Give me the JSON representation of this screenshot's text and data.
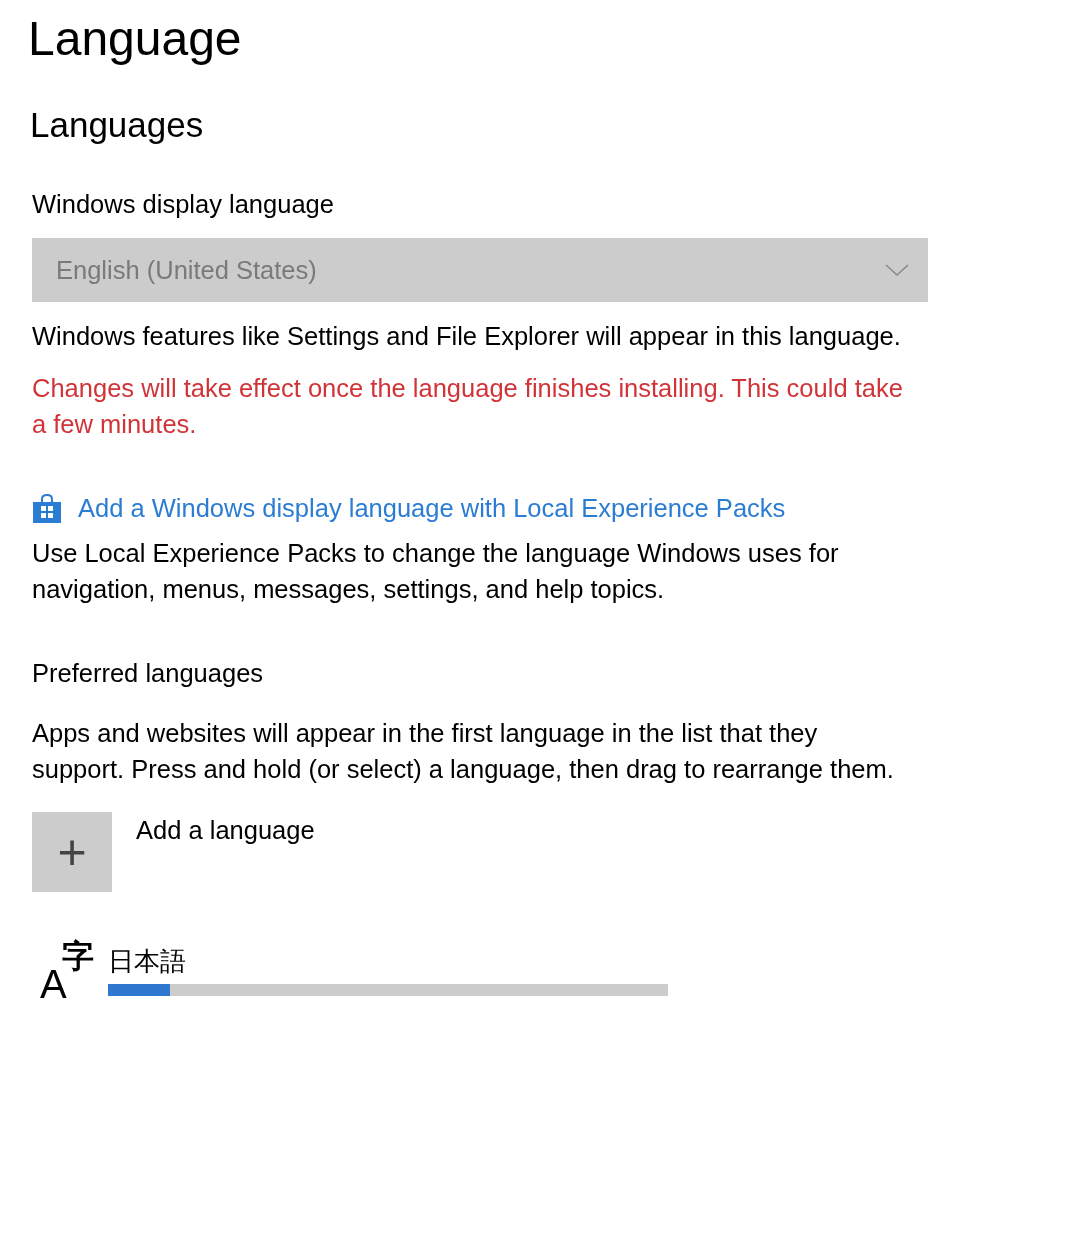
{
  "page_title": "Language",
  "section_title": "Languages",
  "display_language": {
    "label": "Windows display language",
    "value": "English (United States)",
    "disabled": true,
    "description": "Windows features like Settings and File Explorer will appear in this language.",
    "warning": "Changes will take effect once the language finishes installing. This could take a few minutes."
  },
  "local_experience": {
    "link": "Add a Windows display language with Local Experience Packs",
    "description": "Use Local Experience Packs to change the language Windows uses for navigation, menus, messages, settings, and help topics."
  },
  "preferred": {
    "label": "Preferred languages",
    "description": "Apps and websites will appear in the first language in the list that they support. Press and hold (or select) a language, then drag to rearrange them.",
    "add_button": {
      "icon": "+",
      "label": "Add a language"
    },
    "languages": [
      {
        "icon_letter": "A",
        "icon_character": "字",
        "name": "日本語",
        "level": 0.11
      }
    ]
  }
}
